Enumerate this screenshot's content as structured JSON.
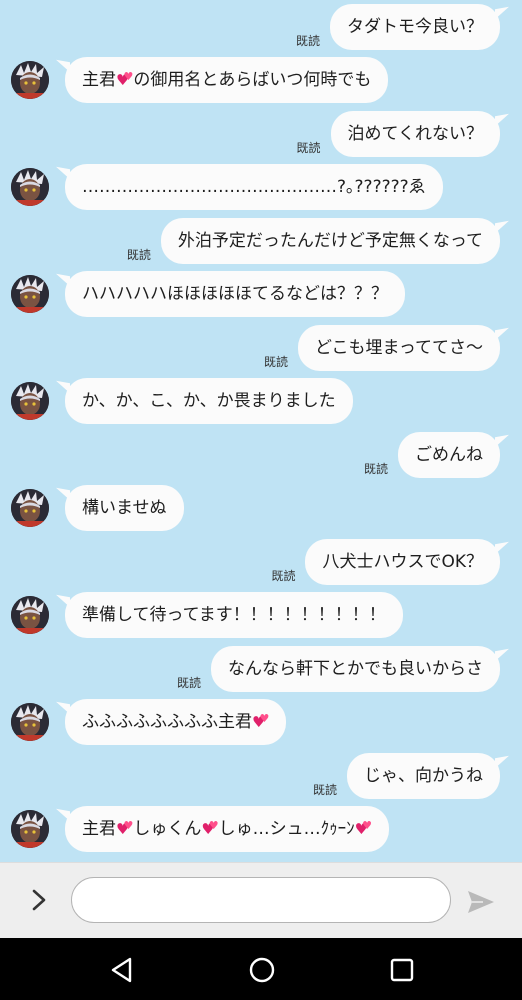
{
  "read_label": "既読",
  "messages": [
    {
      "from": "me",
      "parts": [
        {
          "text": "タダトモ今良い？"
        }
      ]
    },
    {
      "from": "them",
      "parts": [
        {
          "text": "主君"
        },
        {
          "heart": true
        },
        {
          "text": "の御用名とあらばいつ何時でも"
        }
      ]
    },
    {
      "from": "me",
      "parts": [
        {
          "text": "泊めてくれない？"
        }
      ]
    },
    {
      "from": "them",
      "parts": [
        {
          "text": "………………………………………?｡??????ゑ"
        }
      ]
    },
    {
      "from": "me",
      "parts": [
        {
          "text": "外泊予定だったんだけど予定無くなって"
        }
      ]
    },
    {
      "from": "them",
      "parts": [
        {
          "text": "ハハハハハほほほほほてるなどは？？？"
        }
      ]
    },
    {
      "from": "me",
      "parts": [
        {
          "text": "どこも埋まっててさ〜"
        }
      ]
    },
    {
      "from": "them",
      "parts": [
        {
          "text": "か、か、こ、か、か畏まりました"
        }
      ]
    },
    {
      "from": "me",
      "parts": [
        {
          "text": "ごめんね"
        }
      ]
    },
    {
      "from": "them",
      "parts": [
        {
          "text": "構いませぬ"
        }
      ]
    },
    {
      "from": "me",
      "parts": [
        {
          "text": "八犬士ハウスでOK？"
        }
      ]
    },
    {
      "from": "them",
      "parts": [
        {
          "text": "準備して待ってます！！！！！！！！！"
        }
      ]
    },
    {
      "from": "me",
      "parts": [
        {
          "text": "なんなら軒下とかでも良いからさ"
        }
      ]
    },
    {
      "from": "them",
      "parts": [
        {
          "text": "ふふふふふふふふ主君"
        },
        {
          "heart": true
        }
      ]
    },
    {
      "from": "me",
      "parts": [
        {
          "text": "じゃ、向かうね"
        }
      ]
    },
    {
      "from": "them",
      "parts": [
        {
          "text": "主君"
        },
        {
          "heart": true
        },
        {
          "text": "しゅくん"
        },
        {
          "heart": true
        },
        {
          "text": "しゅ…シュ…ｸｩｰﾝ"
        },
        {
          "heart": true
        }
      ]
    }
  ],
  "composer": {
    "value": "",
    "placeholder": ""
  },
  "icons": {
    "menu": "chevron-right-icon",
    "send": "send-icon",
    "back": "nav-back-icon",
    "home": "nav-home-icon",
    "recents": "nav-recents-icon",
    "avatar": "character-avatar",
    "heart": "two-hearts-emoji"
  },
  "colors": {
    "chat_background": "#bfe3f4",
    "bubble": "#fbfbfb",
    "text": "#1e1e1e",
    "heart": "#e0206a",
    "input_bar": "#eeeeee",
    "nav_bar": "#000000"
  }
}
